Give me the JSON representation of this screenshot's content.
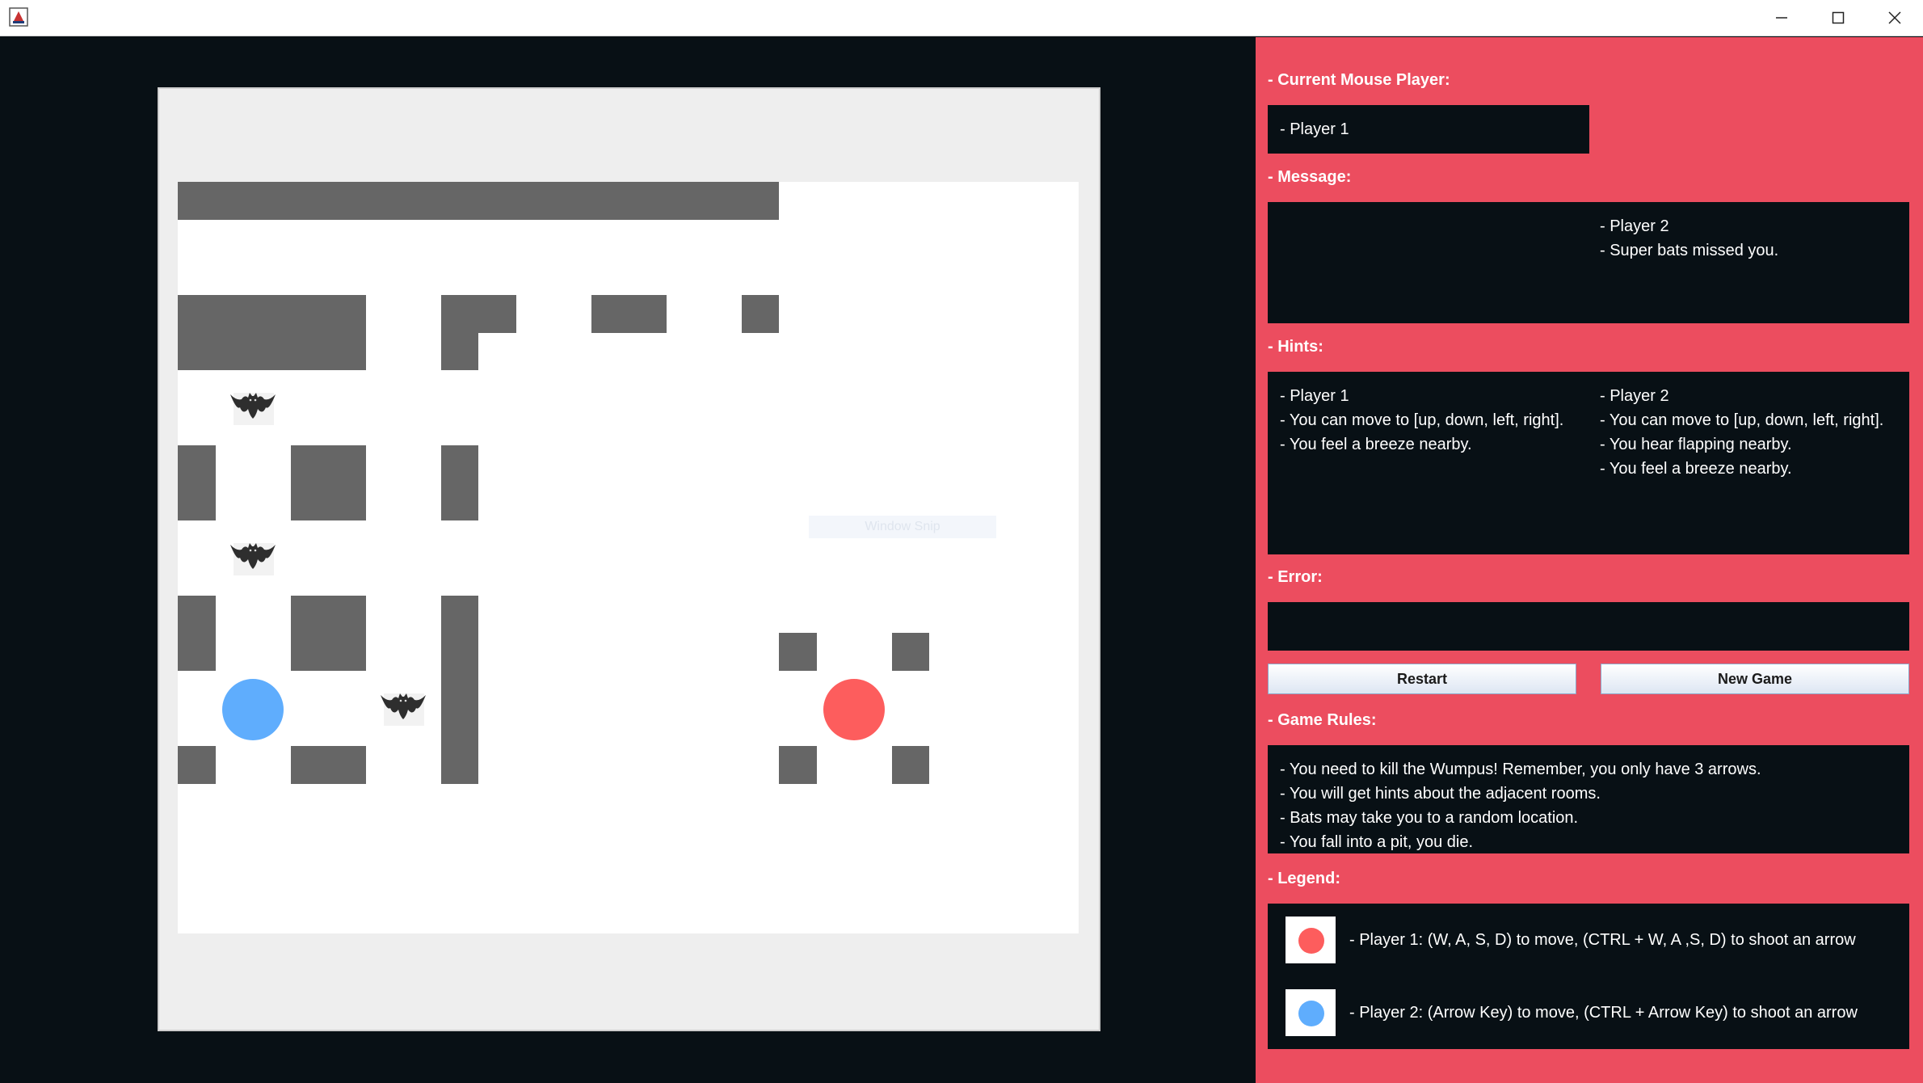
{
  "window": {
    "controls": {
      "minimize": "minimize-icon",
      "maximize": "maximize-icon",
      "close": "close-icon"
    }
  },
  "colors": {
    "panel_bg": "#ec4d5f",
    "dark_bg": "#081015",
    "wall": "#666666",
    "player1": "#fd5d5d",
    "player2": "#5fadfd"
  },
  "panel": {
    "current_player_label": "- Current Mouse Player:",
    "current_player_value": "- Player 1",
    "message_label": "- Message:",
    "message": {
      "player2": [
        "- Player 2",
        "- Super bats missed you."
      ]
    },
    "hints_label": "- Hints:",
    "hints": {
      "player1": [
        "- Player 1",
        "- You can move to [up, down, left, right].",
        "- You feel a breeze nearby."
      ],
      "player2": [
        "- Player 2",
        "- You can move to [up, down, left, right].",
        "- You hear flapping nearby.",
        "- You feel a breeze nearby."
      ]
    },
    "error_label": "- Error:",
    "error_value": "",
    "restart_button": "Restart",
    "new_game_button": "New Game",
    "rules_label": "- Game Rules:",
    "rules": [
      "- You need to kill the Wumpus! Remember, you only have 3 arrows.",
      "- You will get hints about the adjacent rooms.",
      "- Bats may take you to a random location.",
      "- You fall into a pit, you die."
    ],
    "legend_label": "- Legend:",
    "legend": [
      "- Player 1: (W, A, S, D) to move, (CTRL + W, A ,S, D) to shoot an arrow",
      "- Player 2: (Arrow Key) to move, (CTRL + Arrow Key) to shoot an arrow"
    ]
  },
  "watermark": "Window Snip"
}
